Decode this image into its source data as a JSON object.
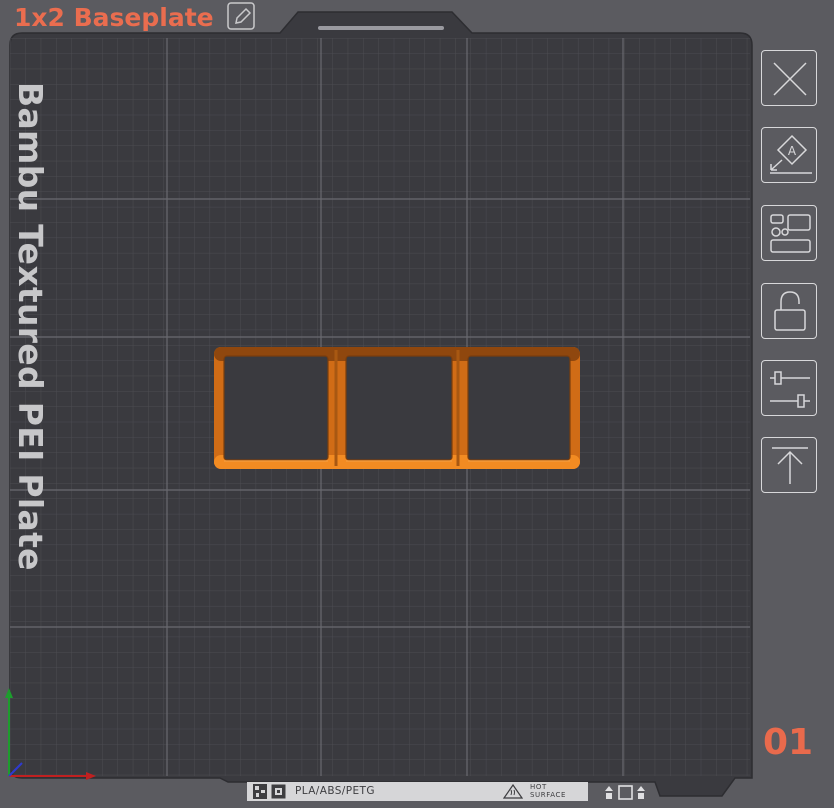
{
  "header": {
    "title": "1x2 Baseplate",
    "edit_icon": "pencil-icon"
  },
  "plate": {
    "label": "Bambu Textured PEI Plate",
    "number": "01",
    "bed_color": "#3a3a3f",
    "grid_color": "#55555b",
    "model_color": "#e07a1c"
  },
  "model": {
    "cells": 3
  },
  "info_strip": {
    "materials": "PLA/ABS/PETG",
    "hot_surface_line1": "HOT",
    "hot_surface_line2": "SURFACE"
  },
  "toolbar": [
    {
      "name": "close-icon"
    },
    {
      "name": "auto-orient-icon"
    },
    {
      "name": "arrange-icon"
    },
    {
      "name": "lock-icon"
    },
    {
      "name": "settings-sliders-icon"
    },
    {
      "name": "move-to-top-icon"
    }
  ],
  "colors": {
    "accent": "#ea6d4f",
    "background": "#5b5b60"
  }
}
